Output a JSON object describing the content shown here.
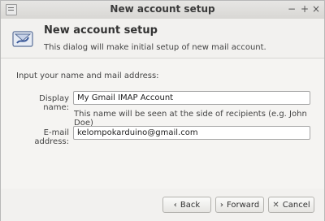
{
  "window": {
    "title": "New account setup",
    "controls": {
      "minimize": "−",
      "maximize": "+",
      "close": "×"
    }
  },
  "header": {
    "title": "New account setup",
    "subtitle": "This dialog will make initial setup of new mail account."
  },
  "form": {
    "section_label": "Input your name and mail address:",
    "display_name_label": "Display name:",
    "display_name_value": "My Gmail IMAP Account",
    "display_name_hint": "This name will be seen at the side of recipients (e.g. John Doe)",
    "email_label": "E-mail address:",
    "email_value": "kelompokarduino@gmail.com"
  },
  "buttons": {
    "back": {
      "label": "Back",
      "icon": "‹"
    },
    "forward": {
      "label": "Forward",
      "icon": "›"
    },
    "cancel": {
      "label": "Cancel",
      "icon": "✕"
    }
  }
}
